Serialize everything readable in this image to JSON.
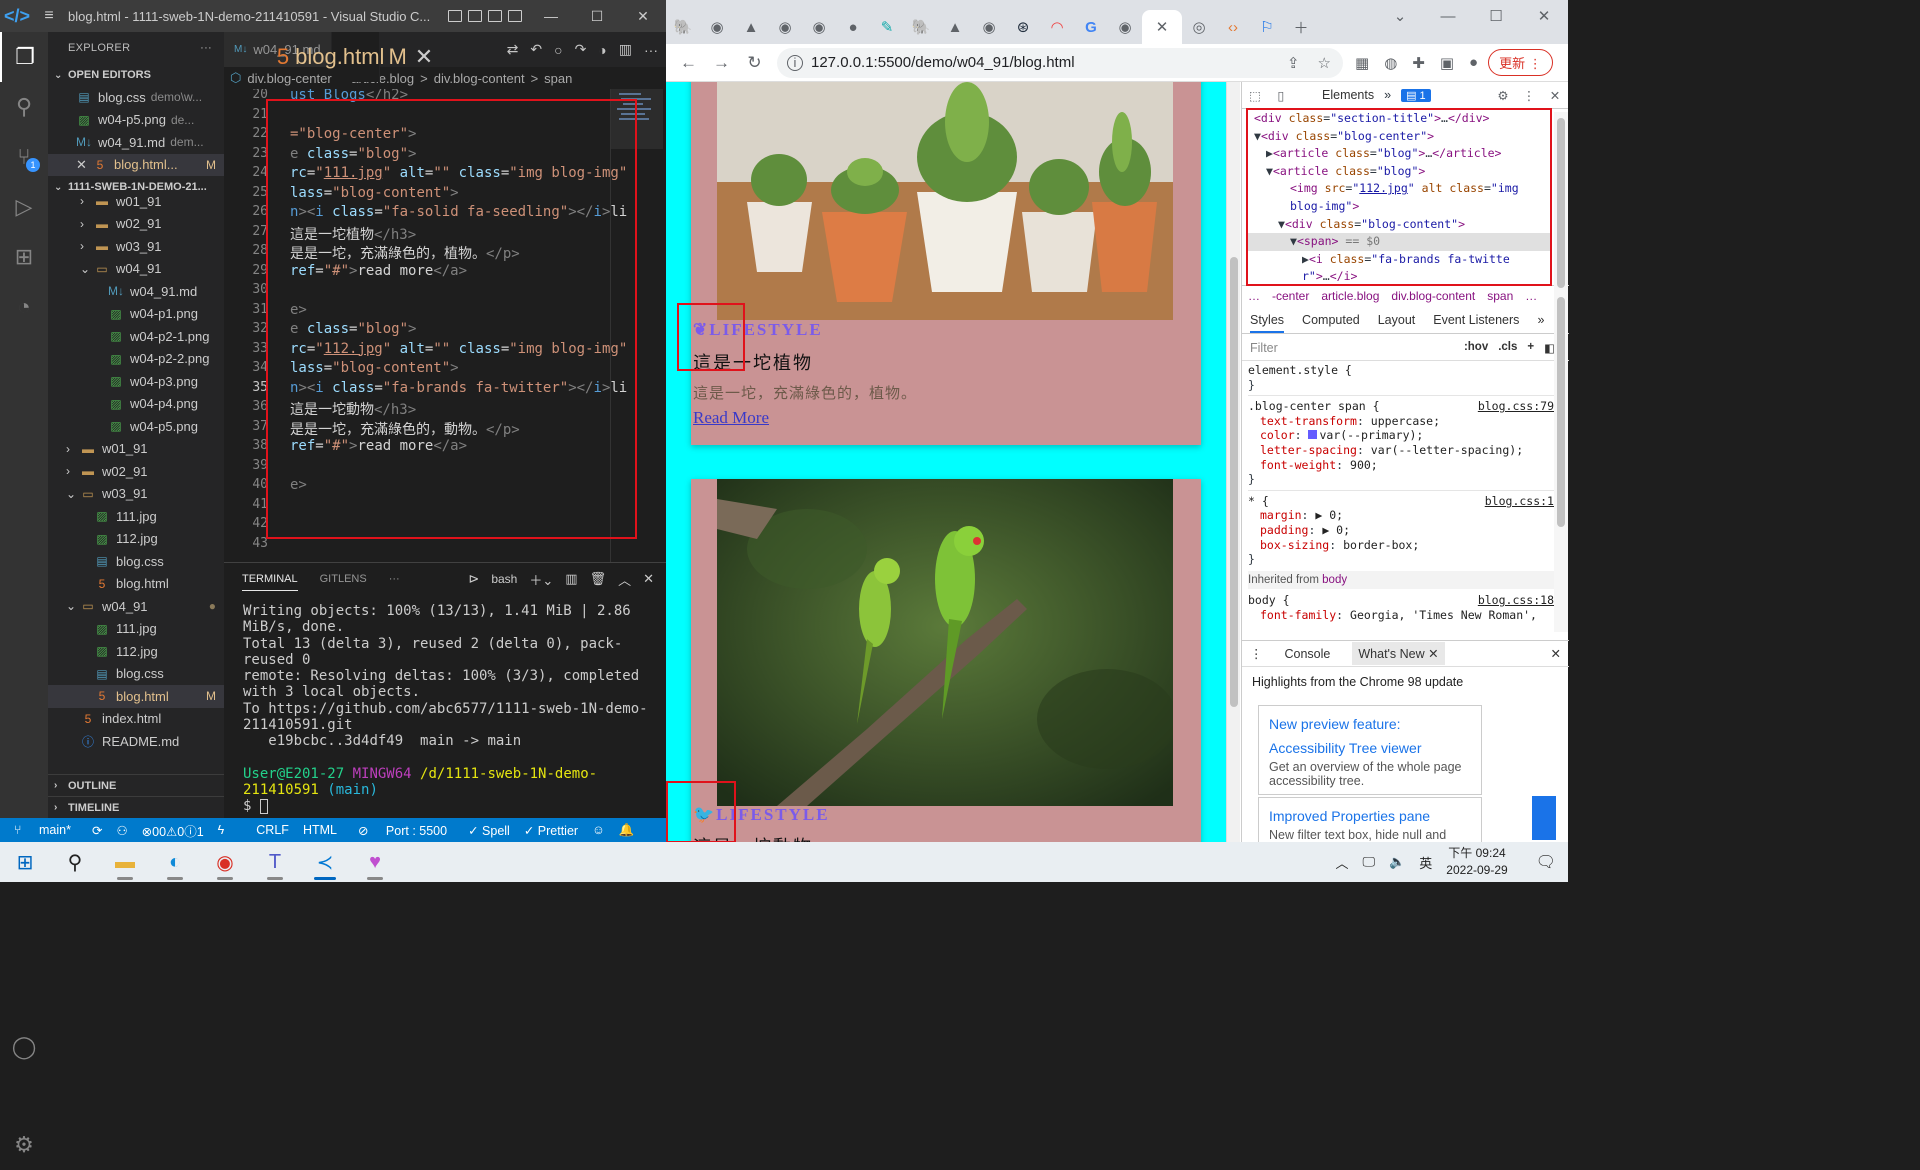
{
  "vscode": {
    "title": "blog.html - 1111-sweb-1N-demo-211410591 - Visual Studio C...",
    "explorer_label": "EXPLORER",
    "open_editors_label": "OPEN EDITORS",
    "open_editors": [
      {
        "name": "blog.css",
        "desc": "demo\\w...",
        "icon": "css"
      },
      {
        "name": "w04-p5.png",
        "desc": "de...",
        "icon": "png"
      },
      {
        "name": "w04_91.md",
        "desc": "dem...",
        "icon": "md"
      },
      {
        "name": "blog.html...",
        "desc": "",
        "icon": "html",
        "mod": "M"
      }
    ],
    "project_label": "1111-SWEB-1N-DEMO-21...",
    "tree": [
      {
        "name": "w01_91",
        "type": "folder",
        "indent": 2,
        "state": "closed"
      },
      {
        "name": "w02_91",
        "type": "folder",
        "indent": 2,
        "state": "closed"
      },
      {
        "name": "w03_91",
        "type": "folder",
        "indent": 2,
        "state": "closed"
      },
      {
        "name": "w04_91",
        "type": "folder",
        "indent": 2,
        "state": "open"
      },
      {
        "name": "w04_91.md",
        "type": "md",
        "indent": 3
      },
      {
        "name": "w04-p1.png",
        "type": "png",
        "indent": 3
      },
      {
        "name": "w04-p2-1.png",
        "type": "png",
        "indent": 3
      },
      {
        "name": "w04-p2-2.png",
        "type": "png",
        "indent": 3
      },
      {
        "name": "w04-p3.png",
        "type": "png",
        "indent": 3
      },
      {
        "name": "w04-p4.png",
        "type": "png",
        "indent": 3
      },
      {
        "name": "w04-p5.png",
        "type": "png",
        "indent": 3
      },
      {
        "name": "w01_91",
        "type": "folder",
        "indent": 1,
        "state": "closed"
      },
      {
        "name": "w02_91",
        "type": "folder",
        "indent": 1,
        "state": "closed"
      },
      {
        "name": "w03_91",
        "type": "folder",
        "indent": 1,
        "state": "open"
      },
      {
        "name": "111.jpg",
        "type": "png",
        "indent": 2
      },
      {
        "name": "112.jpg",
        "type": "png",
        "indent": 2
      },
      {
        "name": "blog.css",
        "type": "css",
        "indent": 2
      },
      {
        "name": "blog.html",
        "type": "html",
        "indent": 2
      },
      {
        "name": "w04_91",
        "type": "folder",
        "indent": 1,
        "state": "open",
        "dot": true
      },
      {
        "name": "111.jpg",
        "type": "png",
        "indent": 2
      },
      {
        "name": "112.jpg",
        "type": "png",
        "indent": 2
      },
      {
        "name": "blog.css",
        "type": "css",
        "indent": 2
      },
      {
        "name": "blog.html",
        "type": "html",
        "indent": 2,
        "mod": "M",
        "selected": true
      },
      {
        "name": "index.html",
        "type": "html",
        "indent": 1
      },
      {
        "name": "README.md",
        "type": "info",
        "indent": 1
      }
    ],
    "outline_label": "OUTLINE",
    "timeline_label": "TIMELINE",
    "tabs": [
      {
        "label": "w04_91.md",
        "icon": "M↓"
      },
      {
        "label": "blog.html",
        "icon": "5",
        "mod": "M",
        "active": true
      }
    ],
    "breadcrumbs": [
      "div.blog-center",
      ">",
      "article.blog",
      ">",
      "div.blog-content",
      ">",
      "span",
      ">"
    ],
    "code_lines": [
      {
        "n": "20",
        "html": "<span class='t-name'>ust Blogs</span><span class='t-tag'>&lt;/h2&gt;</span>"
      },
      {
        "n": "21",
        "html": ""
      },
      {
        "n": "22",
        "html": "<span class='t-str'>=\"blog-center\"</span><span class='t-tag'>&gt;</span>"
      },
      {
        "n": "23",
        "html": "<span class='t-tag'>e </span><span class='t-attr'>class</span>=<span class='t-str'>\"blog\"</span><span class='t-tag'>&gt;</span>"
      },
      {
        "n": "24",
        "html": "<span class='t-attr'>rc</span>=<span class='t-str'>\"</span><span class='t-link'>111.jpg</span><span class='t-str'>\"</span> <span class='t-attr'>alt</span>=<span class='t-str'>\"\"</span> <span class='t-attr'>class</span>=<span class='t-str'>\"img blog-img\"</span>"
      },
      {
        "n": "25",
        "html": "<span class='t-attr'>lass</span>=<span class='t-str'>\"blog-content\"</span><span class='t-tag'>&gt;</span>"
      },
      {
        "n": "26",
        "html": "<span class='t-name'>n</span><span class='t-tag'>&gt;&lt;</span><span class='t-name'>i</span> <span class='t-attr'>class</span>=<span class='t-str'>\"fa-solid fa-seedling\"</span><span class='t-tag'>&gt;&lt;/</span><span class='t-name'>i</span><span class='t-tag'>&gt;</span>li"
      },
      {
        "n": "27",
        "html": "這是一坨植物<span class='t-tag'>&lt;/h3&gt;</span>"
      },
      {
        "n": "28",
        "html": "是是一坨，充滿綠色的，植物。<span class='t-tag'>&lt;/p&gt;</span>"
      },
      {
        "n": "29",
        "html": "<span class='t-attr'>ref</span>=<span class='t-str'>\"#\"</span><span class='t-tag'>&gt;</span>read more<span class='t-tag'>&lt;/a&gt;</span>"
      },
      {
        "n": "30",
        "html": ""
      },
      {
        "n": "31",
        "html": "<span class='t-tag'>e&gt;</span>"
      },
      {
        "n": "32",
        "html": "<span class='t-tag'>e </span><span class='t-attr'>class</span>=<span class='t-str'>\"blog\"</span><span class='t-tag'>&gt;</span>"
      },
      {
        "n": "33",
        "html": "<span class='t-attr'>rc</span>=<span class='t-str'>\"</span><span class='t-link'>112.jpg</span><span class='t-str'>\"</span> <span class='t-attr'>alt</span>=<span class='t-str'>\"\"</span> <span class='t-attr'>class</span>=<span class='t-str'>\"img blog-img\"</span>"
      },
      {
        "n": "34",
        "html": "<span class='t-attr'>lass</span>=<span class='t-str'>\"blog-content\"</span><span class='t-tag'>&gt;</span>"
      },
      {
        "n": "35",
        "html": "<span class='t-name'>n</span><span class='t-tag'>&gt;&lt;</span><span class='t-name'>i</span> <span class='t-attr'>class</span>=<span class='t-str'>\"fa-brands fa-twitter\"</span><span class='t-tag'>&gt;&lt;/</span><span class='t-name'>i</span><span class='t-tag'>&gt;</span>li"
      },
      {
        "n": "36",
        "html": "這是一坨動物<span class='t-tag'>&lt;/h3&gt;</span>"
      },
      {
        "n": "37",
        "html": "是是一坨，充滿綠色的，動物。<span class='t-tag'>&lt;/p&gt;</span>"
      },
      {
        "n": "38",
        "html": "<span class='t-attr'>ref</span>=<span class='t-str'>\"#\"</span><span class='t-tag'>&gt;</span>read more<span class='t-tag'>&lt;/a&gt;</span>"
      },
      {
        "n": "39",
        "html": ""
      },
      {
        "n": "40",
        "html": "<span class='t-tag'>e&gt;</span>"
      },
      {
        "n": "41",
        "html": ""
      },
      {
        "n": "42",
        "html": ""
      },
      {
        "n": "43",
        "html": ""
      }
    ],
    "current_line": "35",
    "panel_tabs": [
      "TERMINAL",
      "GITLENS",
      "···"
    ],
    "shell": "bash",
    "terminal": {
      "l1": "Writing objects: 100% (13/13), 1.41 MiB | 2.86 MiB/s, done.",
      "l2": "Total 13 (delta 3), reused 2 (delta 0), pack-reused 0",
      "l3": "remote: Resolving deltas: 100% (3/3), completed with 3 local objects.",
      "l4": "To https://github.com/abc6577/1111-sweb-1N-demo-211410591.git",
      "l5": "   e19bcbc..3d4df49  main -> main",
      "user": "User@E201-27",
      "host": "MINGW64",
      "path": "/d/1111-sweb-1N-demo-211410591",
      "branch": "(main)",
      "prompt": "$ "
    },
    "status": {
      "branch": "main*",
      "problems": "⊗00⚠0ⓘ1",
      "eol": "CRLF",
      "lang": "HTML",
      "port": "Port : 5500",
      "spell": "✓ Spell",
      "prettier": "✓ Prettier"
    }
  },
  "chrome": {
    "url": "127.0.0.1:5500/demo/w04_91/blog.html",
    "update_label": "更新",
    "page": {
      "card1": {
        "category": "lifestyle",
        "title": "這是一坨植物",
        "text": "這是一坨，充滿綠色的，植物。",
        "more": "Read More",
        "icon": "seedling-icon"
      },
      "card2": {
        "category": "lifestyle",
        "title": "這是一坨動物",
        "icon": "twitter-icon"
      },
      "colors": {
        "page_bg": "#00ffff",
        "card_bg": "#c99394",
        "primary": "#7b5bea"
      }
    }
  },
  "devtools": {
    "tabs": [
      "Elements",
      "»"
    ],
    "issues": "1",
    "dom": [
      {
        "html": "<span class='d-tag'>&lt;div</span> <span class='d-attr'>class</span>=<span class='d-val'>\"section-title\"</span><span class='d-tag'>&gt;</span>…<span class='d-tag'>&lt;/div&gt;</span>",
        "indent": 3
      },
      {
        "html": "▼<span class='d-tag'>&lt;div</span> <span class='d-attr'>class</span>=<span class='d-val'>\"blog-center\"</span><span class='d-tag'>&gt;</span>",
        "indent": 3
      },
      {
        "html": "▶<span class='d-tag'>&lt;article</span> <span class='d-attr'>class</span>=<span class='d-val'>\"blog\"</span><span class='d-tag'>&gt;</span>…<span class='d-tag'>&lt;/article&gt;</span>",
        "indent": 4
      },
      {
        "html": "▼<span class='d-tag'>&lt;article</span> <span class='d-attr'>class</span>=<span class='d-val'>\"blog\"</span><span class='d-tag'>&gt;</span>",
        "indent": 4
      },
      {
        "html": "<span class='d-tag'>&lt;img</span> <span class='d-attr'>src</span>=<span class='d-val'>\"</span><span class='d-lnk'>112.jpg</span><span class='d-val'>\"</span> <span class='d-attr'>alt</span> <span class='d-attr'>class</span>=<span class='d-val'>\"img</span>",
        "indent": 6
      },
      {
        "html": "<span class='d-val'>blog-img\"</span><span class='d-tag'>&gt;</span>",
        "indent": 6
      },
      {
        "html": "▼<span class='d-tag'>&lt;div</span> <span class='d-attr'>class</span>=<span class='d-val'>\"blog-content\"</span><span class='d-tag'>&gt;</span>",
        "indent": 5
      },
      {
        "html": "▼<span class='d-tag'>&lt;span&gt;</span> <span class='d-gray'>== $0</span>",
        "indent": 6,
        "hl": true
      },
      {
        "html": "▶<span class='d-tag'>&lt;i</span> <span class='d-attr'>class</span>=<span class='d-val'>\"fa-brands fa-twitte</span>",
        "indent": 7
      },
      {
        "html": "<span class='d-val'>r\"</span><span class='d-tag'>&gt;</span>…<span class='d-tag'>&lt;/i&gt;</span>",
        "indent": 7
      }
    ],
    "crumbs": [
      "…",
      "-center",
      "article.blog",
      "div.blog-content",
      "span",
      "…"
    ],
    "style_tabs": [
      "Styles",
      "Computed",
      "Layout",
      "Event Listeners",
      "»"
    ],
    "filter_placeholder": "Filter",
    "filter_btns": [
      ":hov",
      ".cls",
      "+"
    ],
    "rules": {
      "element": "element.style {",
      "r1_sel": ".blog-center span {",
      "r1_src": "blog.css:79",
      "r1_props": [
        [
          "text-transform",
          "uppercase;"
        ],
        [
          "color",
          "■var(--primary);"
        ],
        [
          "letter-spacing",
          "var(--letter-spacing);"
        ],
        [
          "font-weight",
          "900;"
        ]
      ],
      "r2_sel": "* {",
      "r2_src": "blog.css:1",
      "r2_props": [
        [
          "margin",
          "▶ 0;"
        ],
        [
          "padding",
          "▶ 0;"
        ],
        [
          "box-sizing",
          "border-box;"
        ]
      ],
      "inherited": "Inherited from",
      "inherited_el": "body",
      "r3_sel": "body {",
      "r3_src": "blog.css:18",
      "r3_props": [
        [
          "font-family",
          "Georgia, 'Times New Roman',"
        ]
      ]
    },
    "drawer_tabs": [
      "Console",
      "What's New"
    ],
    "whats_new_title": "Highlights from the Chrome 98 update",
    "card1_h1": "New preview feature:",
    "card1_h2": "Accessibility Tree viewer",
    "card1_d": "Get an overview of the whole page accessibility tree.",
    "card2_h": "Improved Properties pane",
    "card2_d": "New filter text box, hide null and"
  },
  "taskbar": {
    "time": "下午 09:24",
    "date": "2022-09-29",
    "ime": "英"
  }
}
